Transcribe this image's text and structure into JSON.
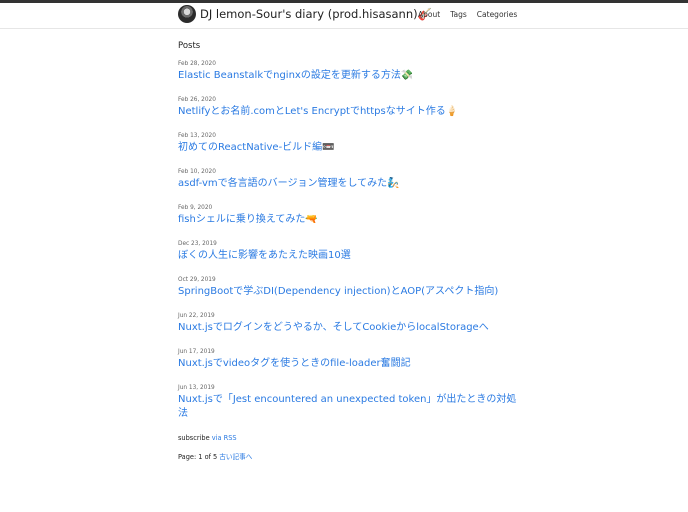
{
  "header": {
    "site_title": "DJ lemon-Sour's diary (prod.hisasann)🎸",
    "nav": [
      "About",
      "Tags",
      "Categories"
    ]
  },
  "main": {
    "section_title": "Posts",
    "posts": [
      {
        "date": "Feb 28, 2020",
        "title": "Elastic Beanstalkでnginxの設定を更新する方法💸"
      },
      {
        "date": "Feb 26, 2020",
        "title": "Netlifyとお名前.comとLet's Encryptでhttpsなサイト作る🍦"
      },
      {
        "date": "Feb 13, 2020",
        "title": "初めてのReactNative-ビルド編📼"
      },
      {
        "date": "Feb 10, 2020",
        "title": "asdf-vmで各言語のバージョン管理をしてみた🧞"
      },
      {
        "date": "Feb 9, 2020",
        "title": "fishシェルに乗り換えてみた🔫"
      },
      {
        "date": "Dec 23, 2019",
        "title": "ぼくの人生に影響をあたえた映画10選"
      },
      {
        "date": "Oct 29, 2019",
        "title": "SpringBootで学ぶDI(Dependency injection)とAOP(アスペクト指向)"
      },
      {
        "date": "Jun 22, 2019",
        "title": "Nuxt.jsでログインをどうやるか、そしてCookieからlocalStorageへ"
      },
      {
        "date": "Jun 17, 2019",
        "title": "Nuxt.jsでvideoタグを使うときのfile-loader奮闘記"
      },
      {
        "date": "Jun 13, 2019",
        "title": "Nuxt.jsで「Jest encountered an unexpected token」が出たときの対処法"
      }
    ],
    "subscribe_label": "subscribe",
    "subscribe_link": "via RSS",
    "pager_label": "Page: 1 of 5",
    "pager_link": "古い記事へ"
  }
}
